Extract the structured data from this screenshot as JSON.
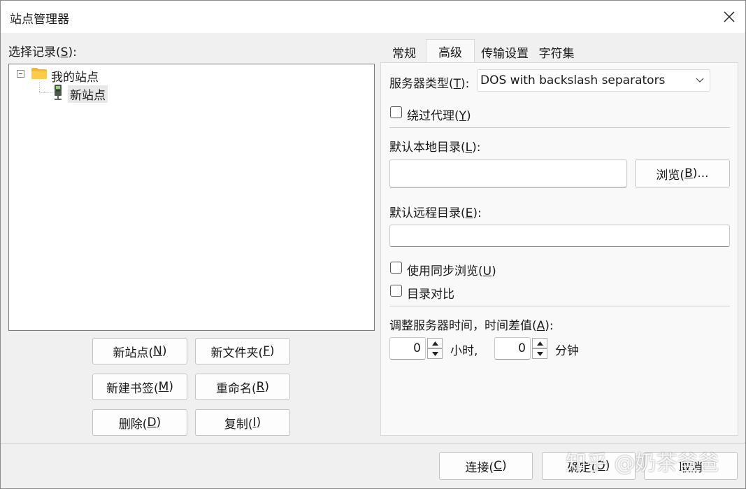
{
  "window": {
    "title": "站点管理器"
  },
  "left": {
    "records_label": "选择记录(",
    "records_key": "S",
    "records_suffix": "):",
    "tree": {
      "root_label": "我的站点",
      "child_label": "新站点"
    },
    "buttons": {
      "new_site": {
        "text": "新站点(",
        "key": "N",
        "suffix": ")"
      },
      "new_folder": {
        "text": "新文件夹(",
        "key": "F",
        "suffix": ")"
      },
      "new_bookmark": {
        "text": "新建书签(",
        "key": "M",
        "suffix": ")"
      },
      "rename": {
        "text": "重命名(",
        "key": "R",
        "suffix": ")"
      },
      "delete": {
        "text": "删除(",
        "key": "D",
        "suffix": ")"
      },
      "copy": {
        "text": "复制(",
        "key": "I",
        "suffix": ")"
      }
    }
  },
  "tabs": [
    {
      "label": "常规"
    },
    {
      "label": "高级"
    },
    {
      "label": "传输设置"
    },
    {
      "label": "字符集"
    }
  ],
  "advanced": {
    "server_type_label": "服务器类型(",
    "server_type_key": "T",
    "server_type_suffix": "):",
    "server_type_value": "DOS with backslash separators",
    "bypass_proxy": {
      "text": "绕过代理(",
      "key": "Y",
      "suffix": ")",
      "checked": false
    },
    "local_dir_label": "默认本地目录(",
    "local_dir_key": "L",
    "local_dir_suffix": "):",
    "local_dir_value": "",
    "browse_button": {
      "text": "浏览(",
      "key": "B",
      "suffix": ")..."
    },
    "remote_dir_label": "默认远程目录(",
    "remote_dir_key": "E",
    "remote_dir_suffix": "):",
    "remote_dir_value": "",
    "sync_browse": {
      "text": "使用同步浏览(",
      "key": "U",
      "suffix": ")",
      "checked": false
    },
    "dir_compare": {
      "text": "目录对比",
      "checked": false
    },
    "time_offset_label": "调整服务器时间，时间差值(",
    "time_offset_key": "A",
    "time_offset_suffix": "):",
    "hours_value": "0",
    "hours_unit": "小时,",
    "minutes_value": "0",
    "minutes_unit": "分钟"
  },
  "footer": {
    "connect": {
      "text": "连接(",
      "key": "C",
      "suffix": ")"
    },
    "ok": {
      "text": "确定(",
      "key": "O",
      "suffix": ")"
    },
    "cancel": {
      "text": "取消"
    }
  },
  "watermark": "知乎 @奶茶爸爸",
  "colors": {
    "folder": "#f5b82e",
    "window_bg": "#f0f0f0",
    "panel_bg": "#f9f9f9"
  }
}
